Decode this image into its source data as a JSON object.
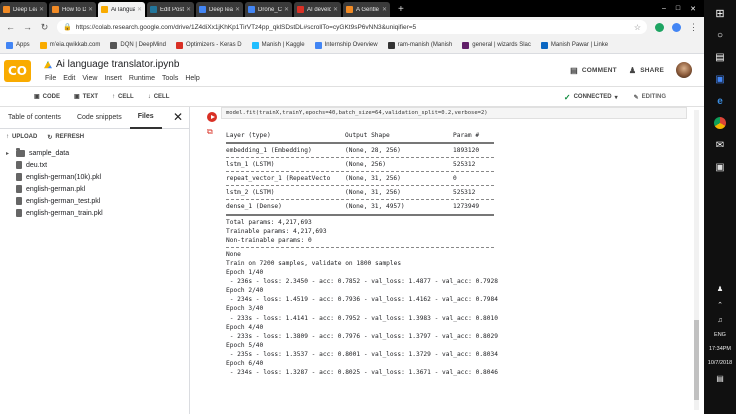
{
  "browser": {
    "tabs": [
      {
        "label": "Deep Learni",
        "color": "#f28b25",
        "active": false
      },
      {
        "label": "How to Deve",
        "color": "#f28b25",
        "active": false
      },
      {
        "label": "Ai language",
        "color": "#f9ab00",
        "active": true
      },
      {
        "label": "Edit Post ‹ Ni",
        "color": "#21759b",
        "active": false
      },
      {
        "label": "Deep learnin",
        "color": "#4285f4",
        "active": false
      },
      {
        "label": "Drone_Comp",
        "color": "#4285f4",
        "active": false
      },
      {
        "label": "AI developm",
        "color": "#d93025",
        "active": false
      },
      {
        "label": "A Gentle Intr",
        "color": "#f28b25",
        "active": false
      }
    ],
    "new_tab": "+",
    "url": "https://colab.research.google.com/drive/1Z4diXx1jKhKp1TirVTz4pp_qklSDstDL#scrollTo=cyGKt9sP6vNN3&uniqifier=5",
    "bookmarks": [
      {
        "label": "Apps",
        "color": "#4285f4"
      },
      {
        "label": "m’eia.qwikkab.com",
        "color": "#f9ab00"
      },
      {
        "label": "DQN | DeepMind",
        "color": "#555555"
      },
      {
        "label": "Optimizers - Keras D",
        "color": "#d93025"
      },
      {
        "label": "Manish | Kaggle",
        "color": "#20beff"
      },
      {
        "label": "Internship Overview",
        "color": "#4285f4"
      },
      {
        "label": "ram-manish (Manish",
        "color": "#333333"
      },
      {
        "label": "general | wizards Slac",
        "color": "#611f69"
      },
      {
        "label": "Manish Pawar | Linke",
        "color": "#0a66c2"
      }
    ],
    "window_controls": [
      "–",
      "□",
      "✕"
    ]
  },
  "colab": {
    "logo": "CO",
    "notebook_title": "Ai language translator.ipynb",
    "menu": [
      "File",
      "Edit",
      "View",
      "Insert",
      "Runtime",
      "Tools",
      "Help"
    ],
    "comment_label": "COMMENT",
    "share_label": "SHARE",
    "toolbar": {
      "code_label": "CODE",
      "text_label": "TEXT",
      "cell_up_label": "CELL",
      "cell_down_label": "CELL",
      "connected_label": "CONNECTED",
      "editing_label": "EDITING"
    }
  },
  "sidebar": {
    "tabs": [
      "Table of contents",
      "Code snippets",
      "Files"
    ],
    "active_tab": "Files",
    "upload_label": "UPLOAD",
    "refresh_label": "REFRESH",
    "files": [
      {
        "name": "sample_data",
        "type": "folder"
      },
      {
        "name": "deu.txt",
        "type": "file"
      },
      {
        "name": "english-german(10k).pkl",
        "type": "file"
      },
      {
        "name": "english-german.pkl",
        "type": "file"
      },
      {
        "name": "english-german_test.pkl",
        "type": "file"
      },
      {
        "name": "english-german_train.pkl",
        "type": "file"
      }
    ]
  },
  "cell": {
    "code_line": "model.fit(trainX,trainY,epochs=40,batch_size=64,validation_split=0.2,verbose=2)",
    "summary_header": {
      "layer": "Layer (type)",
      "shape": "Output Shape",
      "params": "Param #"
    },
    "layers": [
      {
        "layer": "embedding_1 (Embedding)",
        "shape": "(None, 28, 256)",
        "params": "1893120"
      },
      {
        "layer": "lstm_1 (LSTM)",
        "shape": "(None, 256)",
        "params": "525312"
      },
      {
        "layer": "repeat_vector_1 (RepeatVecto",
        "shape": "(None, 31, 256)",
        "params": "0"
      },
      {
        "layer": "lstm_2 (LSTM)",
        "shape": "(None, 31, 256)",
        "params": "525312"
      },
      {
        "layer": "dense_1 (Dense)",
        "shape": "(None, 31, 4957)",
        "params": "1273949"
      }
    ],
    "total_params": "Total params: 4,217,693",
    "trainable_params": "Trainable params: 4,217,693",
    "non_trainable_params": "Non-trainable params: 0",
    "none_line": "None",
    "train_line": "Train on 7200 samples, validate on 1800 samples",
    "epochs": [
      {
        "epoch": "Epoch 1/40",
        "stats": " - 236s - loss: 2.3450 - acc: 0.7852 - val_loss: 1.4877 - val_acc: 0.7928"
      },
      {
        "epoch": "Epoch 2/40",
        "stats": " - 234s - loss: 1.4519 - acc: 0.7936 - val_loss: 1.4162 - val_acc: 0.7984"
      },
      {
        "epoch": "Epoch 3/40",
        "stats": " - 233s - loss: 1.4141 - acc: 0.7952 - val_loss: 1.3983 - val_acc: 0.8010"
      },
      {
        "epoch": "Epoch 4/40",
        "stats": " - 233s - loss: 1.3809 - acc: 0.7976 - val_loss: 1.3797 - val_acc: 0.8029"
      },
      {
        "epoch": "Epoch 5/40",
        "stats": " - 235s - loss: 1.3537 - acc: 0.8001 - val_loss: 1.3729 - val_acc: 0.8034"
      },
      {
        "epoch": "Epoch 6/40",
        "stats": " - 234s - loss: 1.3287 - acc: 0.8025 - val_loss: 1.3671 - val_acc: 0.8046"
      }
    ]
  },
  "taskbar": {
    "language": "ENG",
    "time": "17:34PM",
    "date": "10/7/2018"
  }
}
